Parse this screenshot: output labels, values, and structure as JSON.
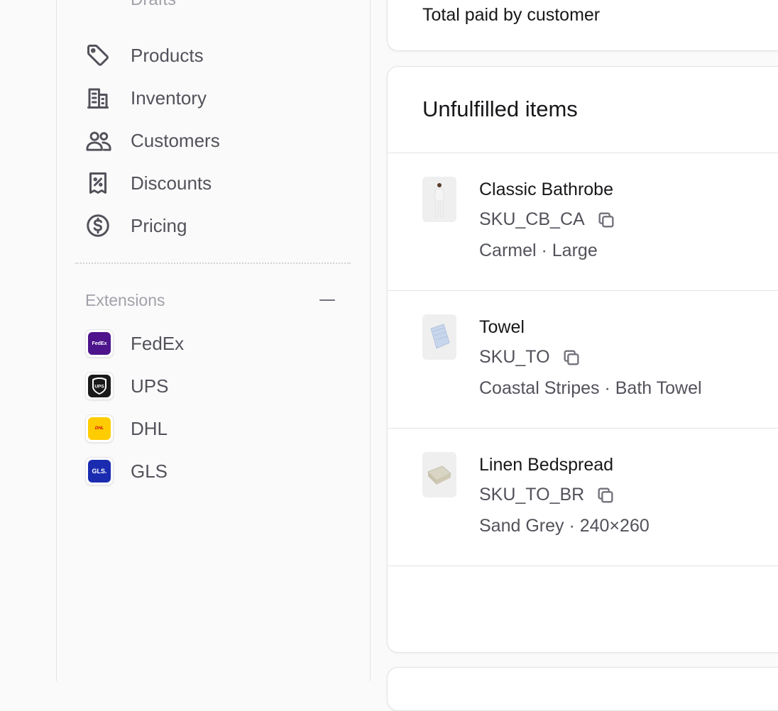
{
  "sidebar": {
    "faded_item": "Drafts",
    "items": [
      {
        "label": "Products",
        "icon": "tag-icon"
      },
      {
        "label": "Inventory",
        "icon": "building-icon"
      },
      {
        "label": "Customers",
        "icon": "users-icon"
      },
      {
        "label": "Discounts",
        "icon": "receipt-percent-icon"
      },
      {
        "label": "Pricing",
        "icon": "dollar-circle-icon"
      }
    ],
    "extensions": {
      "title": "Extensions",
      "items": [
        {
          "label": "FedEx",
          "logo_text": "FedEx",
          "color": "#4d148c"
        },
        {
          "label": "UPS",
          "logo_text": "UPS",
          "color": "#1a1a1a"
        },
        {
          "label": "DHL",
          "logo_text": "DHL",
          "color": "#ffcc00"
        },
        {
          "label": "GLS",
          "logo_text": "GLS.",
          "color": "#1a2bb0"
        }
      ]
    }
  },
  "main": {
    "summary_card": {
      "title": "Total paid by customer"
    },
    "unfulfilled": {
      "heading": "Unfulfilled items",
      "items": [
        {
          "name": "Classic Bathrobe",
          "sku": "SKU_CB_CA",
          "variant": "Carmel · Large"
        },
        {
          "name": "Towel",
          "sku": "SKU_TO",
          "variant": "Coastal Stripes · Bath Towel"
        },
        {
          "name": "Linen Bedspread",
          "sku": "SKU_TO_BR",
          "variant": "Sand Grey · 240×260"
        }
      ]
    }
  }
}
